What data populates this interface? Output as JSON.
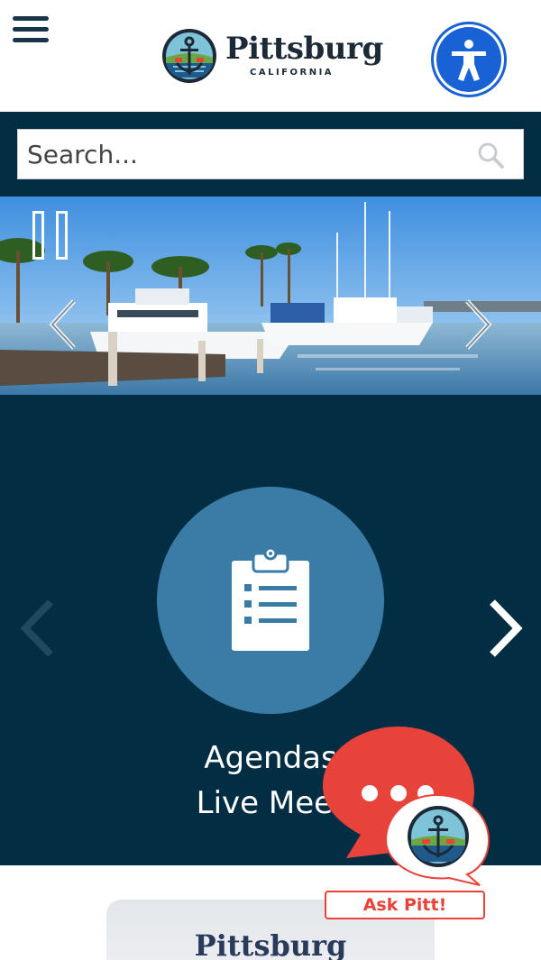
{
  "header": {
    "logo_name": "Pittsburg",
    "logo_sub": "CALIFORNIA"
  },
  "search": {
    "placeholder": "Search..."
  },
  "quick_links": {
    "current_line1": "Agendas",
    "current_line2": "Live Meet"
  },
  "chat": {
    "label": "Ask Pitt!"
  },
  "footer": {
    "logo_name": "Pittsburg"
  },
  "colors": {
    "navy": "#032d42",
    "circle": "#3b7ca6",
    "accessibility": "#1862d6",
    "chat_red": "#e8433a"
  },
  "icons": [
    "menu-icon",
    "accessibility-icon",
    "search-icon",
    "pause-icon",
    "chevron-left-icon",
    "chevron-right-icon",
    "clipboard-list-icon",
    "chat-bubble-icon"
  ]
}
